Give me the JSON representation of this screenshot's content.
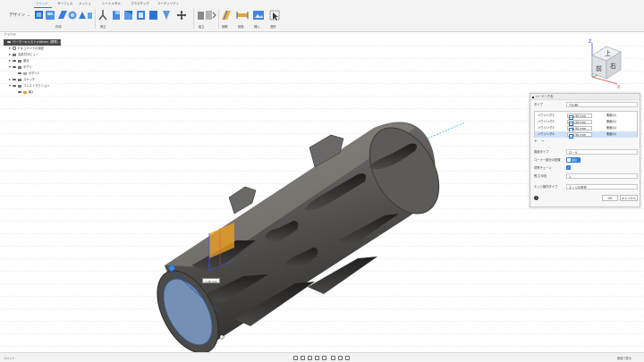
{
  "toolbar": {
    "workspace_label": "デザイン",
    "tabs": [
      "ソリッド",
      "サーフェス",
      "メッシュ",
      "シートメタル",
      "プラスチック",
      "ユーティリティ"
    ],
    "groups": [
      "作成",
      "修正",
      "組立",
      "構築",
      "検査",
      "挿入",
      "選択"
    ]
  },
  "browser": {
    "title": "ブラウザ",
    "items": [
      {
        "label": "ベーマーキャスト×10mm（標準）v2"
      },
      {
        "label": "ドキュメントの設定"
      },
      {
        "label": "名前付きビュー"
      },
      {
        "label": "原点"
      },
      {
        "label": "ボディ"
      },
      {
        "label": "ボディ1"
      },
      {
        "label": "スケッチ"
      },
      {
        "label": "コンストラクション"
      },
      {
        "label": "軸1"
      }
    ]
  },
  "dialog": {
    "title": "ハードー穴を",
    "type_label": "タイプ",
    "type_value": "穴の個",
    "rows": [
      {
        "name": "ハウジング1",
        "value": "1.50 mm",
        "dir": "側面(1)"
      },
      {
        "name": "ハウジング2",
        "value": "1.50 mm",
        "dir": "側面(1)"
      },
      {
        "name": "ハウジング3",
        "value": "1.50 mm",
        "dir": "側面(1)"
      },
      {
        "name": "ハウジング4",
        "value": "1.50 mm",
        "dir": "側面(1)"
      }
    ],
    "corner_label": "角部タイプ",
    "corner_value": "ロール",
    "pattern_label": "コーナー部分の配置",
    "toggle_label": "連続",
    "boundary_label": "境界チェーン",
    "length_label": "長さ/半径",
    "length_value": "1",
    "operation_label": "エッジ操作タイプ",
    "operation_value": "エッジの選択",
    "ok": "OK",
    "cancel": "キャンセル"
  },
  "viewcube": {
    "top": "上",
    "front": "前",
    "right": "右",
    "axis_x": "X",
    "axis_z": "Z"
  },
  "viewport": {
    "dimension_value": "1.50 mm"
  },
  "bottombar": {
    "left_label": "コメント",
    "right_label": "数値で表示"
  }
}
